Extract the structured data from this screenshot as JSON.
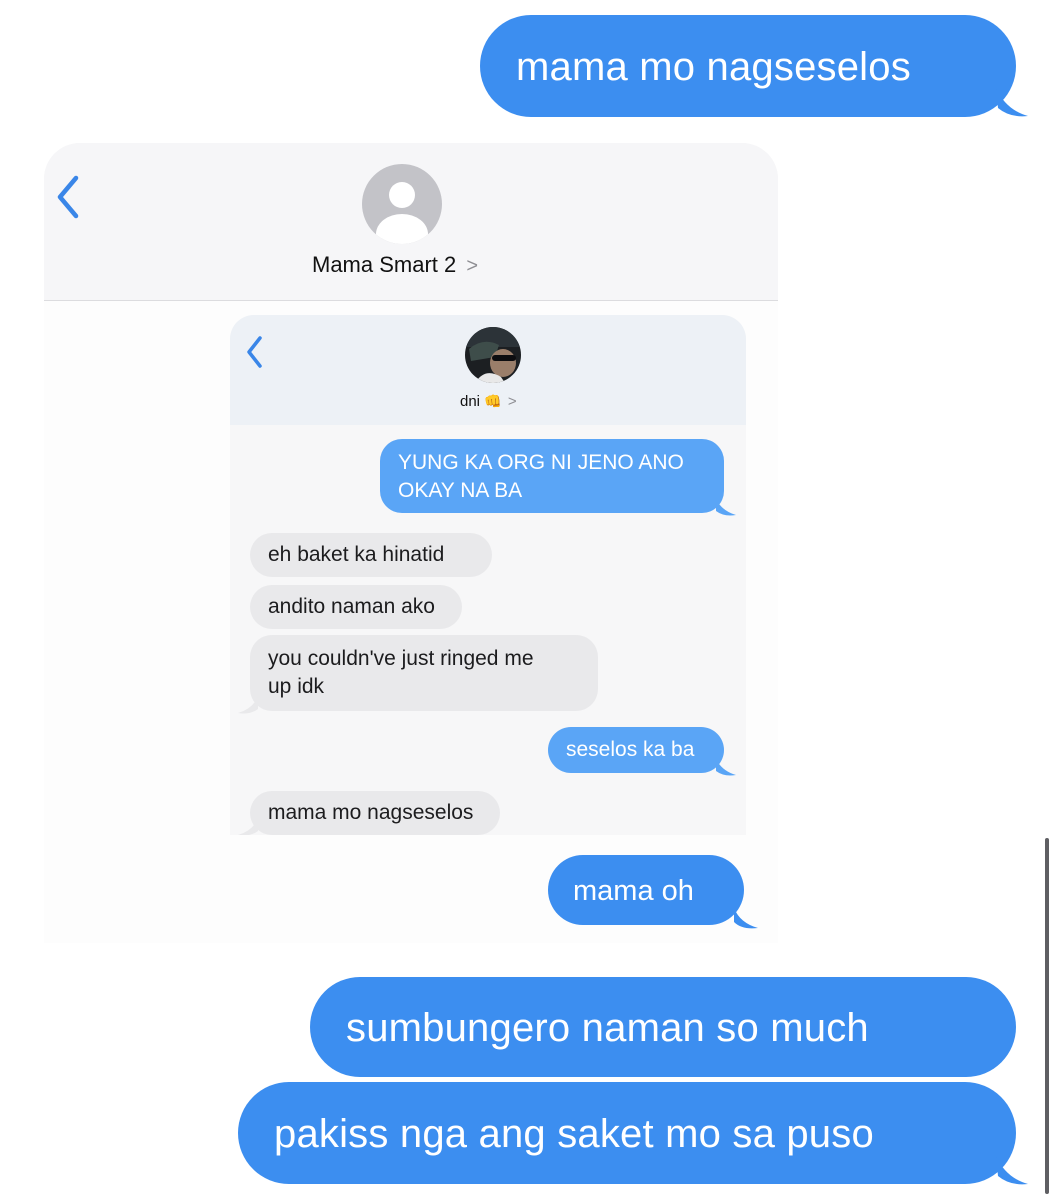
{
  "outer": {
    "top_message": "mama mo nagseselos",
    "bottom_messages": [
      "sumbungero naman so much",
      "pakiss nga ang saket mo sa puso"
    ]
  },
  "shot1": {
    "contact_name": "Mama Smart 2",
    "contact_chevron": ">",
    "back_glyph": "‹",
    "sent_message": "mama oh"
  },
  "shot2": {
    "contact_name": "dni",
    "contact_emoji": "👊",
    "contact_chevron": ">",
    "back_glyph": "‹",
    "messages": [
      {
        "from": "me",
        "lines": [
          "YUNG KA ORG NI JENO ANO",
          "OKAY NA BA"
        ]
      },
      {
        "from": "them",
        "lines": [
          "eh baket ka hinatid"
        ]
      },
      {
        "from": "them",
        "lines": [
          "andito naman ako"
        ]
      },
      {
        "from": "them",
        "lines": [
          "you couldn've just ringed me",
          "up idk"
        ]
      },
      {
        "from": "me",
        "lines": [
          "seselos ka ba"
        ]
      },
      {
        "from": "them",
        "lines": [
          "mama mo nagseselos"
        ]
      }
    ]
  },
  "colors": {
    "imessage_blue": "#3c8ef0",
    "received_grey": "#e9e9eb",
    "link_blue": "#3a86e8"
  }
}
